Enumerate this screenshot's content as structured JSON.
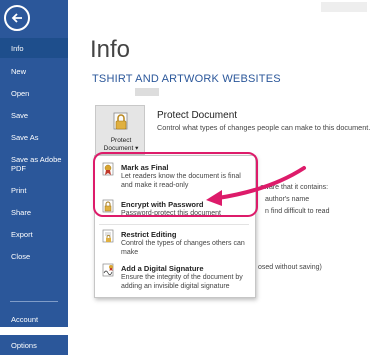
{
  "sidebar": {
    "items": [
      {
        "label": "Info",
        "active": true
      },
      {
        "label": "New"
      },
      {
        "label": "Open"
      },
      {
        "label": "Save"
      },
      {
        "label": "Save As"
      },
      {
        "label": "Save as Adobe PDF"
      },
      {
        "label": "Print"
      },
      {
        "label": "Share"
      },
      {
        "label": "Export"
      },
      {
        "label": "Close"
      },
      {
        "label": "Account"
      },
      {
        "label": "Options"
      }
    ]
  },
  "main": {
    "page_title": "Info",
    "doc_title": "TSHIRT AND ARTWORK WEBSITES",
    "protect": {
      "button_label": "Protect Document",
      "button_caret": "▾",
      "heading": "Protect Document",
      "description": "Control what types of changes people can make to this document."
    },
    "background_text": {
      "line1": "aware that it contains:",
      "line2": "author's name",
      "line3": "n find difficult to read",
      "line4": "osed without saving)"
    }
  },
  "dropdown": {
    "items": [
      {
        "title": "Mark as Final",
        "desc": "Let readers know the document is final and make it read-only",
        "icon": "ribbon-icon"
      },
      {
        "title": "Encrypt with Password",
        "desc": "Password-protect this document",
        "icon": "lock-icon"
      },
      {
        "title": "Restrict Editing",
        "desc": "Control the types of changes others can make",
        "icon": "restrict-editing-icon"
      },
      {
        "title": "Add a Digital Signature",
        "desc": "Ensure the integrity of the document by adding an invisible digital signature",
        "icon": "signature-icon"
      }
    ]
  },
  "colors": {
    "sidebar": "#2b579a",
    "active": "#1e4e8c",
    "accent": "#2b579a",
    "highlight": "#dd1b6a"
  }
}
